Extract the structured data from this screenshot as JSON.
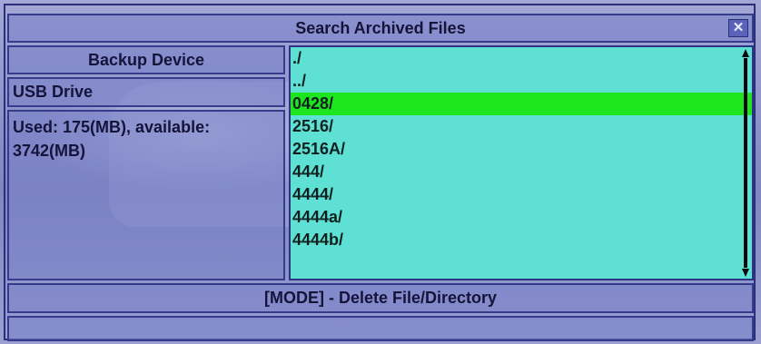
{
  "window": {
    "title": "Search Archived Files",
    "close_icon": "close-icon"
  },
  "device_panel": {
    "label": "Backup Device",
    "device_name": "USB Drive",
    "usage": "Used: 175(MB), available: 3742(MB)"
  },
  "file_list": {
    "items": [
      "./",
      "../",
      "0428/",
      "2516/",
      "2516A/",
      "444/",
      "4444/",
      "4444a/",
      "4444b/"
    ],
    "selected_index": 2
  },
  "hint": "[MODE] - Delete File/Directory",
  "status": "",
  "colors": {
    "background": "#8f95c9",
    "list_background": "#5fe0d4",
    "selection": "#1ee61e",
    "border": "#353c8c"
  }
}
